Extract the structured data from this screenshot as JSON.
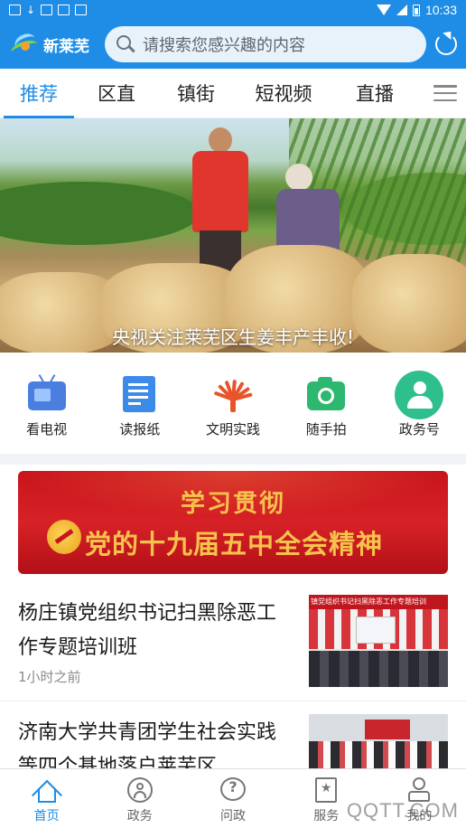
{
  "status_bar": {
    "time": "10:33"
  },
  "header": {
    "app_name": "新莱芜",
    "search_placeholder": "请搜索您感兴趣的内容"
  },
  "tabs": [
    {
      "label": "推荐",
      "active": true
    },
    {
      "label": "区直"
    },
    {
      "label": "镇街"
    },
    {
      "label": "短视频"
    },
    {
      "label": "直播"
    }
  ],
  "banner": {
    "caption": "央视关注莱芜区生姜丰产丰收!"
  },
  "shortcuts": [
    {
      "label": "看电视",
      "icon": "tv-icon"
    },
    {
      "label": "读报纸",
      "icon": "newspaper-icon"
    },
    {
      "label": "文明实践",
      "icon": "civilization-fan-icon"
    },
    {
      "label": "随手拍",
      "icon": "camera-icon"
    },
    {
      "label": "政务号",
      "icon": "gov-account-icon"
    }
  ],
  "promo": {
    "line1": "学习贯彻",
    "line2": "党的十九届五中全会精神"
  },
  "news": [
    {
      "title": "杨庄镇党组织书记扫黑除恶工作专题培训班",
      "time": "1小时之前",
      "thumb_caption": "镇党组织书记扫黑除恶工作专题培训"
    },
    {
      "title": "济南大学共青团学生社会实践等四个基地落户莱芜区..."
    }
  ],
  "bottom_nav": [
    {
      "label": "首页",
      "active": true
    },
    {
      "label": "政务"
    },
    {
      "label": "问政"
    },
    {
      "label": "服务"
    },
    {
      "label": "我的"
    }
  ],
  "watermark": "QQTT.COM",
  "colors": {
    "brand_blue": "#1f8de6",
    "promo_red": "#c8141c",
    "promo_gold": "#f6c24c"
  }
}
